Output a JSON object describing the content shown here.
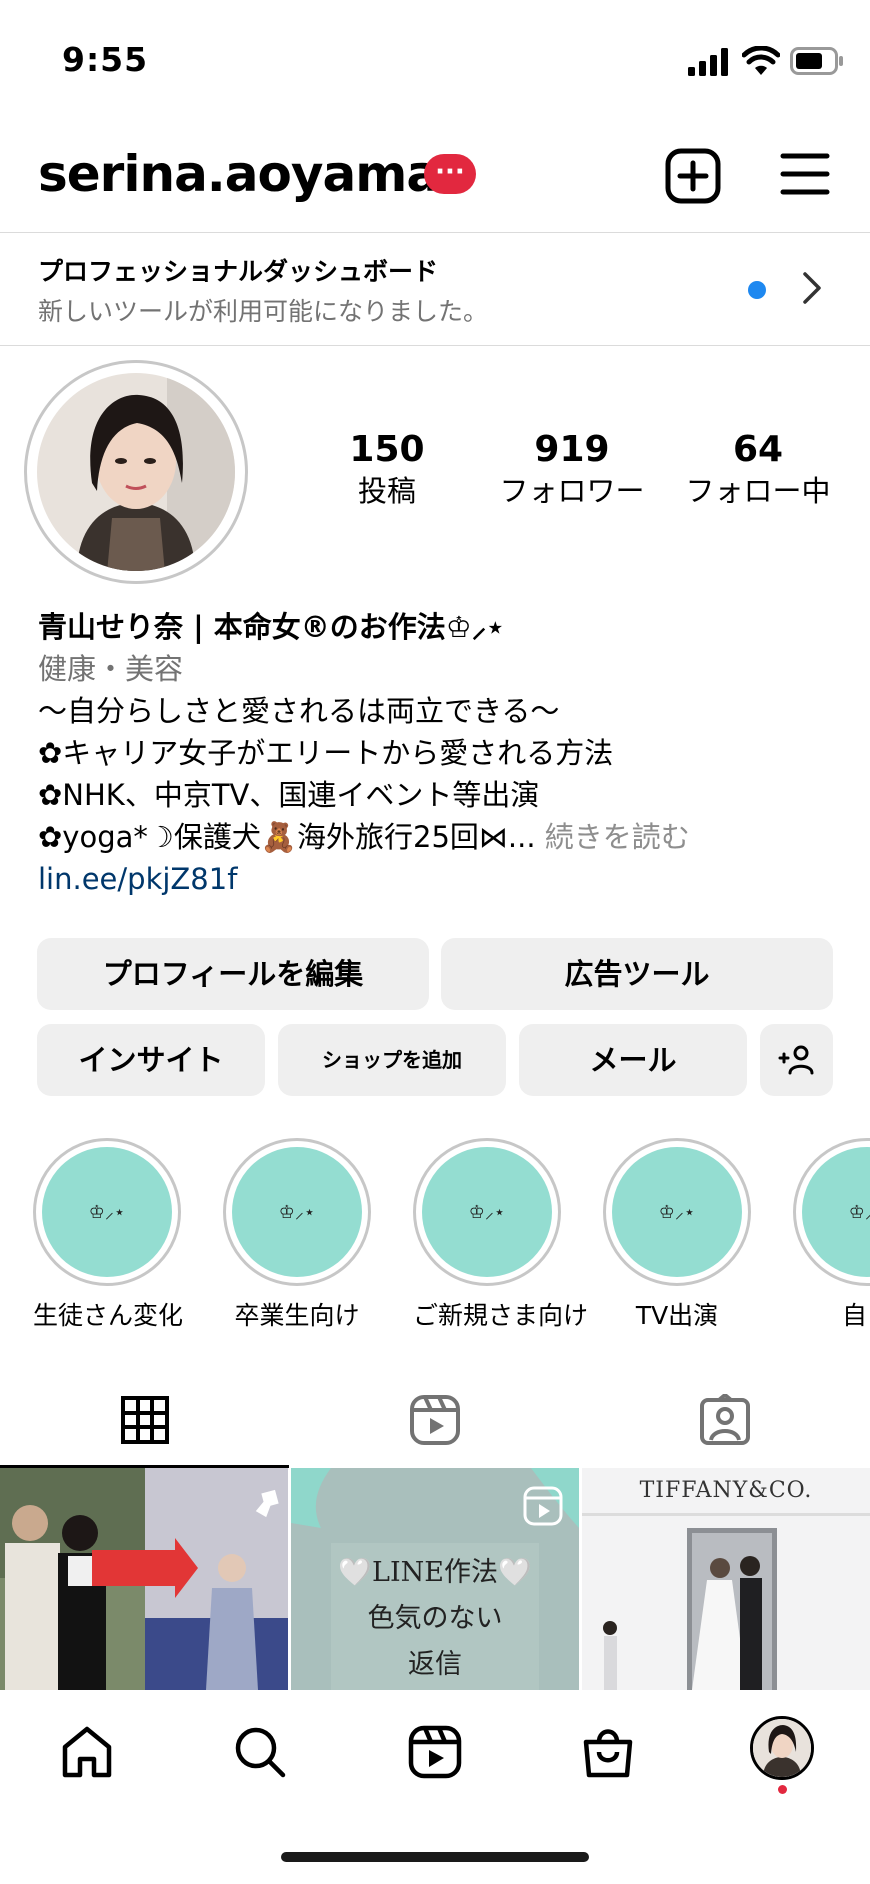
{
  "status_bar": {
    "time": "9:55"
  },
  "header": {
    "username": "serina.aoyama",
    "badge": "···"
  },
  "pro_dashboard": {
    "title": "プロフェッショナルダッシュボード",
    "subtitle": "新しいツールが利用可能になりました。"
  },
  "stats": [
    {
      "value": "150",
      "label": "投稿"
    },
    {
      "value": "919",
      "label": "フォロワー"
    },
    {
      "value": "64",
      "label": "フォロー中"
    }
  ],
  "bio": {
    "name": "青山せり奈 | 本命女®のお作法♔⸝⋆",
    "category": "健康・美容",
    "line1": "〜自分らしさと愛されるは両立できる〜",
    "line2": "✿キャリア女子がエリートから愛される方法",
    "line3": "✿NHK、中京TV、国連イベント等出演",
    "line4": "✿yoga*☽保護犬🧸海外旅行25回⋈...",
    "more": " 続きを読む",
    "link": "lin.ee/pkjZ81f"
  },
  "buttons": {
    "edit_profile": "プロフィールを編集",
    "ad_tools": "広告ツール",
    "insights": "インサイト",
    "add_shop": "ショップを追加",
    "email": "メール"
  },
  "highlights": [
    {
      "icon_text": "♔⸝⋆",
      "label": "生徒さん変化"
    },
    {
      "icon_text": "♔⸝⋆",
      "label": "卒業生向け"
    },
    {
      "icon_text": "♔⸝⋆",
      "label": "ご新規さま向け"
    },
    {
      "icon_text": "♔⸝⋆",
      "label": "TV出演"
    },
    {
      "icon_text": "♔⸝⋆",
      "label": "自己"
    }
  ],
  "grid": {
    "post2_line1": "🤍LINE作法🤍",
    "post2_line2": "色気のない",
    "post2_line3": "返信",
    "post3_brand": "TIFFANY&CO."
  },
  "colors": {
    "badge": "#e2283f",
    "highlight_fill": "#94ddd1",
    "link": "#00376b",
    "notify_dot": "#1e88f0"
  },
  "icons": [
    "add-post-icon",
    "menu-icon",
    "chevron-right-icon",
    "grid-icon",
    "reels-icon",
    "tagged-icon",
    "home-icon",
    "search-icon",
    "shop-icon",
    "pin-icon"
  ]
}
